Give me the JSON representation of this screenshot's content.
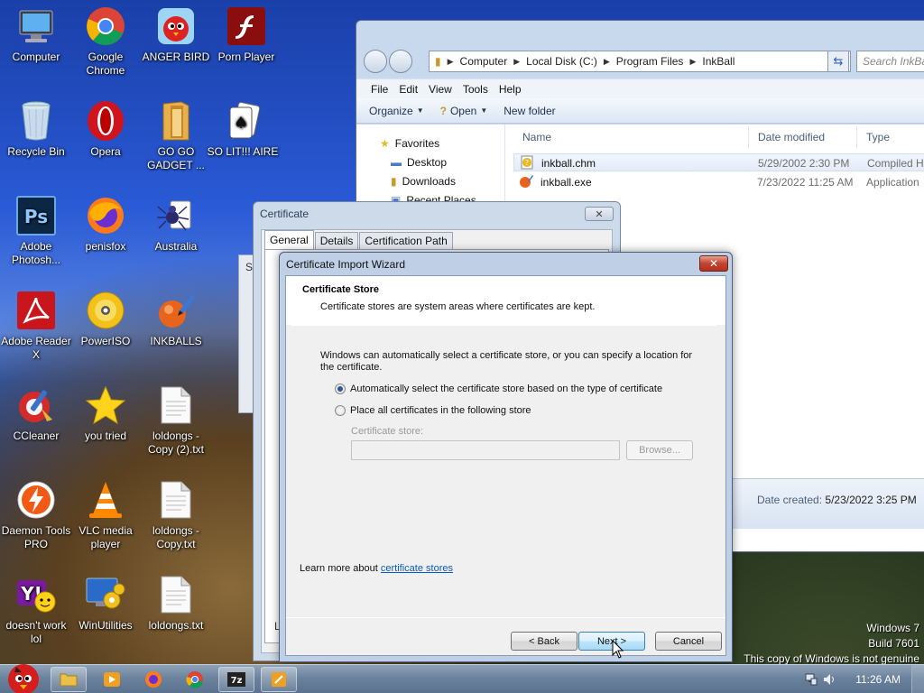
{
  "desktop": {
    "icons": [
      {
        "label": "Computer",
        "icon": "computer-icon"
      },
      {
        "label": "Google Chrome",
        "icon": "chrome-icon"
      },
      {
        "label": "ANGER BIRD",
        "icon": "angry-bird-icon"
      },
      {
        "label": "Porn Player",
        "icon": "flash-player-icon"
      },
      {
        "label": "Recycle Bin",
        "icon": "recycle-bin-icon"
      },
      {
        "label": "Opera",
        "icon": "opera-icon"
      },
      {
        "label": "GO GO GADGET ...",
        "icon": "folder-icon"
      },
      {
        "label": "SO LIT!!! AIRE",
        "icon": "cards-icon"
      },
      {
        "label": "Adobe Photosh...",
        "icon": "photoshop-icon"
      },
      {
        "label": "penisfox",
        "icon": "firefox-icon"
      },
      {
        "label": "Australia",
        "icon": "spider-solitaire-icon"
      },
      {
        "label": "Adobe Reader X",
        "icon": "adobe-reader-icon"
      },
      {
        "label": "PowerISO",
        "icon": "poweriso-icon"
      },
      {
        "label": "INKBALLS",
        "icon": "inkball-icon"
      },
      {
        "label": "CCleaner",
        "icon": "ccleaner-icon"
      },
      {
        "label": "you tried",
        "icon": "star-icon"
      },
      {
        "label": "loldongs - Copy (2).txt",
        "icon": "text-file-icon"
      },
      {
        "label": "Daemon Tools PRO",
        "icon": "daemon-tools-icon"
      },
      {
        "label": "VLC media player",
        "icon": "vlc-icon"
      },
      {
        "label": "loldongs - Copy.txt",
        "icon": "text-file-icon"
      },
      {
        "label": "doesn't work lol",
        "icon": "yahoo-messenger-icon"
      },
      {
        "label": "WinUtilities",
        "icon": "winutilities-icon"
      },
      {
        "label": "loldongs.txt",
        "icon": "text-file-icon"
      }
    ]
  },
  "explorer": {
    "breadcrumb": [
      "Computer",
      "Local Disk (C:)",
      "Program Files",
      "InkBall"
    ],
    "search_placeholder": "Search InkBall",
    "menu": [
      "File",
      "Edit",
      "View",
      "Tools",
      "Help"
    ],
    "toolbar": {
      "organize": "Organize",
      "open": "Open",
      "new_folder": "New folder"
    },
    "nav": [
      "Favorites",
      "Desktop",
      "Downloads",
      "Recent Places"
    ],
    "columns": {
      "name": "Name",
      "date": "Date modified",
      "type": "Type"
    },
    "files": [
      {
        "name": "inkball.chm",
        "date": "5/29/2002 2:30 PM",
        "type": "Compiled H",
        "icon": "help-file-icon"
      },
      {
        "name": "inkball.exe",
        "date": "7/23/2022 11:25 AM",
        "type": "Application",
        "icon": "inkball-exe-icon"
      }
    ],
    "details": {
      "label": "Date created:",
      "value": "5/23/2022 3:25 PM"
    }
  },
  "background_window": {
    "fragment": "Se"
  },
  "certificate": {
    "title": "Certificate",
    "close": "✕",
    "tabs": [
      "General",
      "Details",
      "Certification Path"
    ],
    "body_fragment": "Le"
  },
  "wizard": {
    "title": "Certificate Import Wizard",
    "close": "✕",
    "heading": "Certificate Store",
    "subheading": "Certificate stores are system areas where certificates are kept.",
    "intro_line1": "Windows can automatically select a certificate store, or you can specify a location for",
    "intro_line2": "the certificate.",
    "option_auto": "Automatically select the certificate store based on the type of certificate",
    "option_manual": "Place all certificates in the following store",
    "store_label": "Certificate store:",
    "browse": "Browse...",
    "learn_prefix": "Learn more about ",
    "learn_link": "certificate stores",
    "back": "< Back",
    "next": "Next >",
    "cancel": "Cancel"
  },
  "watermark": {
    "line1": "Windows 7",
    "line2": "Build 7601",
    "line3": "This copy of Windows is not genuine"
  },
  "taskbar": {
    "clock": "11:26 AM"
  }
}
